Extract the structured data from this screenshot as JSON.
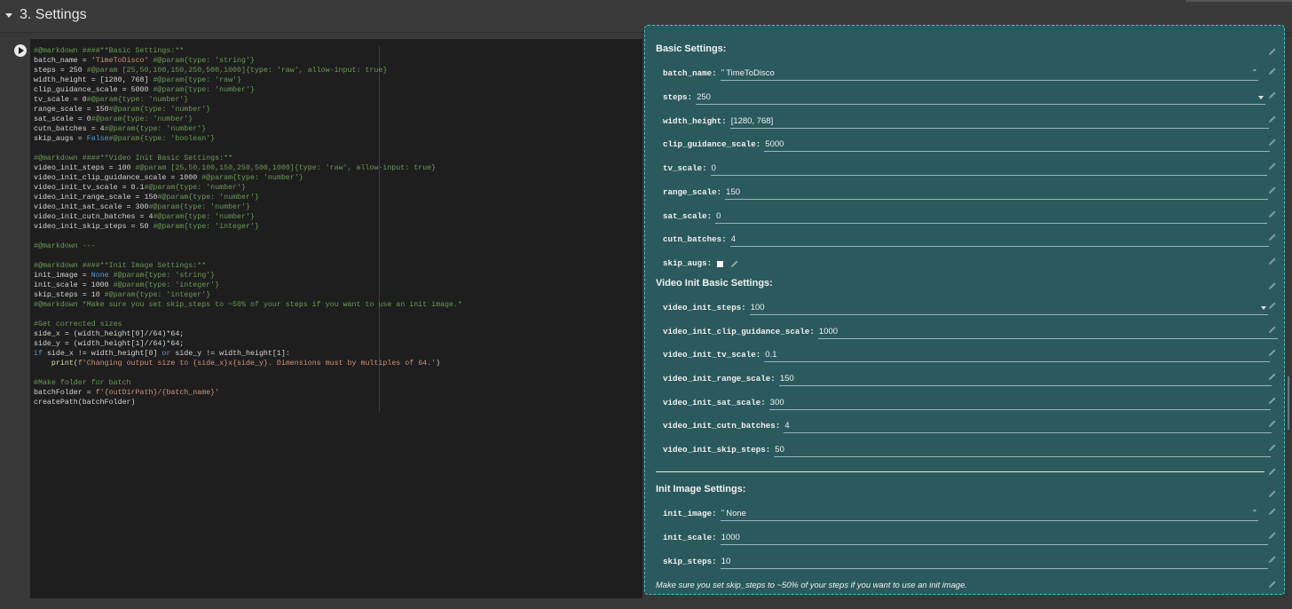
{
  "section": {
    "title": "3. Settings"
  },
  "code_lines": [
    "#@markdown ####**Basic Settings:**",
    "batch_name = 'TimeToDisco' #@param{type: 'string'}",
    "steps = 250 #@param [25,50,100,150,250,500,1000]{type: 'raw', allow-input: true}",
    "width_height = [1280, 768] #@param{type: 'raw'}",
    "clip_guidance_scale = 5000 #@param{type: 'number'}",
    "tv_scale = 0#@param{type: 'number'}",
    "range_scale = 150#@param{type: 'number'}",
    "sat_scale = 0#@param{type: 'number'}",
    "cutn_batches = 4#@param{type: 'number'}",
    "skip_augs = False#@param{type: 'boolean'}",
    "",
    "#@markdown ####**Video Init Basic Settings:**",
    "video_init_steps = 100 #@param [25,50,100,150,250,500,1000]{type: 'raw', allow-input: true}",
    "video_init_clip_guidance_scale = 1000 #@param{type: 'number'}",
    "video_init_tv_scale = 0.1#@param{type: 'number'}",
    "video_init_range_scale = 150#@param{type: 'number'}",
    "video_init_sat_scale = 300#@param{type: 'number'}",
    "video_init_cutn_batches = 4#@param{type: 'number'}",
    "video_init_skip_steps = 50 #@param{type: 'integer'}",
    "",
    "#@markdown ---",
    "",
    "#@markdown ####**Init Image Settings:**",
    "init_image = None #@param{type: 'string'}",
    "init_scale = 1000 #@param{type: 'integer'}",
    "skip_steps = 10 #@param{type: 'integer'}",
    "#@markdown *Make sure you set skip_steps to ~50% of your steps if you want to use an init image.*",
    "",
    "#Get corrected sizes",
    "side_x = (width_height[0]//64)*64;",
    "side_y = (width_height[1]//64)*64;",
    "if side_x != width_height[0] or side_y != width_height[1]:",
    "    print(f'Changing output size to {side_x}x{side_y}. Dimensions must by multiples of 64.')",
    "",
    "#Make folder for batch",
    "batchFolder = f'{outDirPath}/{batch_name}'",
    "createPath(batchFolder)"
  ],
  "form": {
    "basic_heading": "Basic Settings:",
    "basic_fields": [
      {
        "label": "batch_name:",
        "value": "TimeToDisco",
        "quote_open": "\"",
        "quote_close": "\""
      },
      {
        "label": "steps:",
        "value": "250"
      },
      {
        "label": "width_height:",
        "value": "[1280, 768]"
      },
      {
        "label": "clip_guidance_scale:",
        "value": "5000"
      },
      {
        "label": "tv_scale:",
        "value": "0"
      },
      {
        "label": "range_scale:",
        "value": "150"
      },
      {
        "label": "sat_scale:",
        "value": "0"
      },
      {
        "label": "cutn_batches:",
        "value": "4"
      },
      {
        "label": "skip_augs:",
        "value": ""
      }
    ],
    "video_heading": "Video Init Basic Settings:",
    "video_fields": [
      {
        "label": "video_init_steps:",
        "value": "100"
      },
      {
        "label": "video_init_clip_guidance_scale:",
        "value": "1000"
      },
      {
        "label": "video_init_tv_scale:",
        "value": "0.1"
      },
      {
        "label": "video_init_range_scale:",
        "value": "150"
      },
      {
        "label": "video_init_sat_scale:",
        "value": "300"
      },
      {
        "label": "video_init_cutn_batches:",
        "value": "4"
      },
      {
        "label": "video_init_skip_steps:",
        "value": "50"
      }
    ],
    "init_heading": "Init Image Settings:",
    "init_fields": [
      {
        "label": "init_image:",
        "value": "None",
        "quote_open": "\"",
        "quote_close": "\""
      },
      {
        "label": "init_scale:",
        "value": "1000"
      },
      {
        "label": "skip_steps:",
        "value": "10"
      }
    ],
    "note": "Make sure you set skip_steps to ~50% of your steps if you want to use an init image."
  },
  "colors": {
    "form_bg": "#2b5a5e",
    "form_border": "#3bc7c9",
    "code_bg": "#1e1e1e",
    "comment": "#6a9955",
    "string": "#ce9178",
    "keyword": "#569cd6"
  }
}
